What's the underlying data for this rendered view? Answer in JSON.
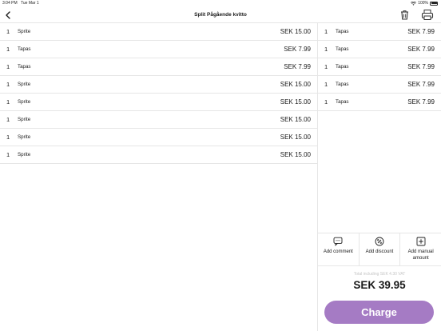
{
  "status_bar": {
    "time": "3:04 PM",
    "date": "Tue Mar 1",
    "battery": "100%"
  },
  "nav": {
    "title": "Split Pågående kvitto",
    "back_icon": "chevron-left-icon",
    "trash_icon": "trash-icon",
    "print_icon": "printer-icon"
  },
  "left_items": [
    {
      "qty": "1",
      "name": "Sprite",
      "price": "SEK 15.00"
    },
    {
      "qty": "1",
      "name": "Tapas",
      "price": "SEK 7.99"
    },
    {
      "qty": "1",
      "name": "Tapas",
      "price": "SEK 7.99"
    },
    {
      "qty": "1",
      "name": "Sprite",
      "price": "SEK 15.00"
    },
    {
      "qty": "1",
      "name": "Sprite",
      "price": "SEK 15.00"
    },
    {
      "qty": "1",
      "name": "Sprite",
      "price": "SEK 15.00"
    },
    {
      "qty": "1",
      "name": "Sprite",
      "price": "SEK 15.00"
    },
    {
      "qty": "1",
      "name": "Sprite",
      "price": "SEK 15.00"
    }
  ],
  "right_items": [
    {
      "qty": "1",
      "name": "Tapas",
      "price": "SEK 7.99"
    },
    {
      "qty": "1",
      "name": "Tapas",
      "price": "SEK 7.99"
    },
    {
      "qty": "1",
      "name": "Tapas",
      "price": "SEK 7.99"
    },
    {
      "qty": "1",
      "name": "Tapas",
      "price": "SEK 7.99"
    },
    {
      "qty": "1",
      "name": "Tapas",
      "price": "SEK 7.99"
    }
  ],
  "actions": {
    "comment": {
      "label": "Add comment",
      "icon": "comment-icon"
    },
    "discount": {
      "label": "Add discount",
      "icon": "discount-icon"
    },
    "manual": {
      "label": "Add manual amount",
      "icon": "add-amount-icon"
    }
  },
  "summary": {
    "vat_text": "Total including SEK 4.30 VAT",
    "total": "SEK 39.95"
  },
  "charge": {
    "label": "Charge"
  },
  "colors": {
    "accent": "#a57bc4",
    "divider": "#e6e6e6",
    "muted": "#c5c5c5"
  }
}
